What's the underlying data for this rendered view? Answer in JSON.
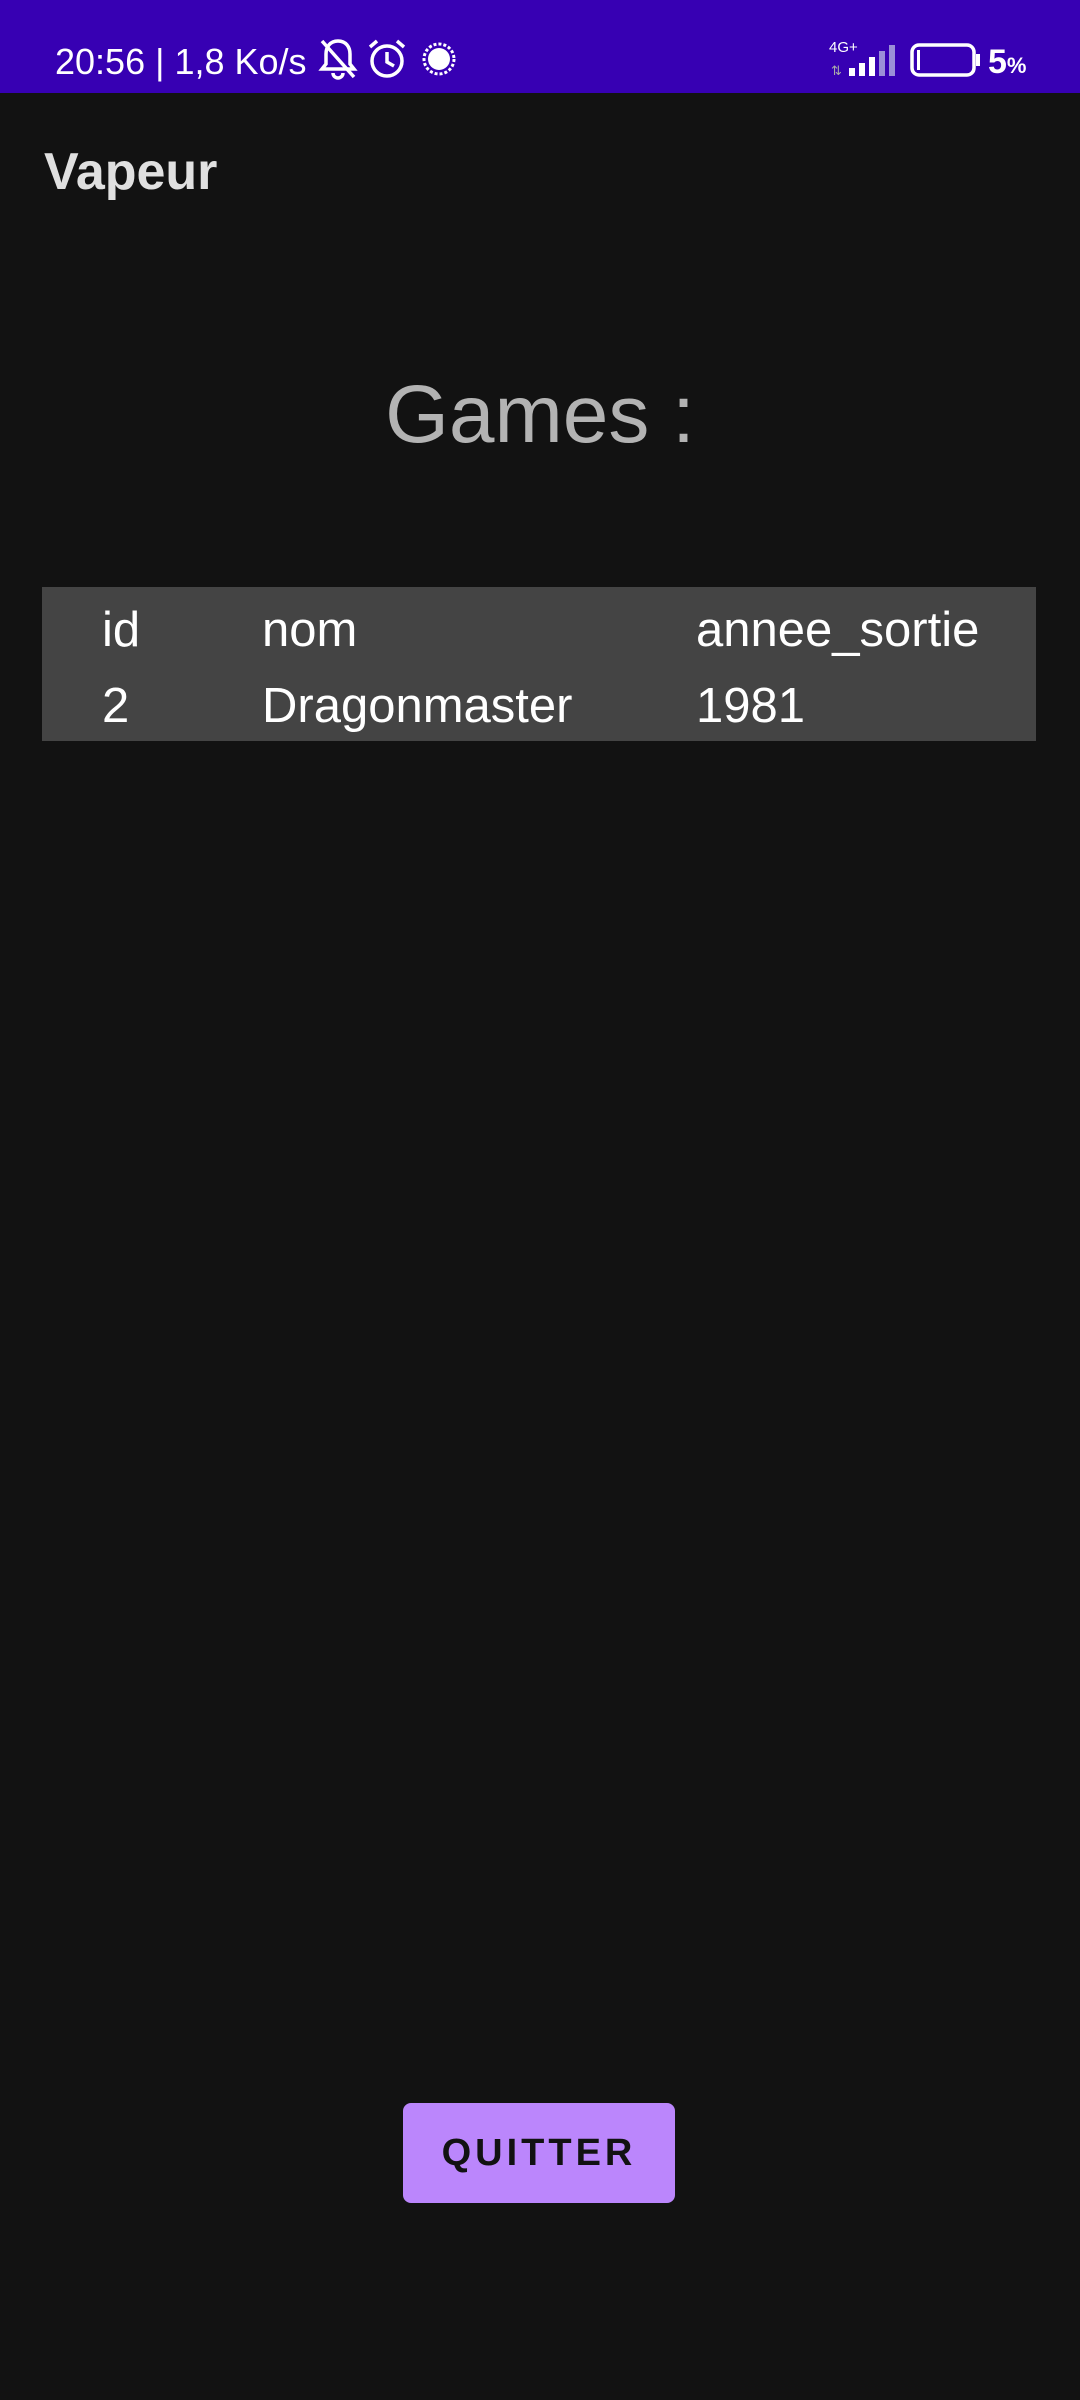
{
  "status_bar": {
    "time_speed": "20:56 | 1,8 Ko/s",
    "network": "4G+",
    "battery_pct": "5",
    "battery_pct_sign": "%",
    "icons": [
      "bell-off-icon",
      "alarm-icon",
      "notification-dot-icon",
      "signal-icon",
      "battery-icon"
    ],
    "color": "#3700b3"
  },
  "app_bar": {
    "title": "Vapeur"
  },
  "main": {
    "heading": "Games :",
    "table": {
      "headers": [
        "id",
        "nom",
        "annee_sortie"
      ],
      "rows": [
        [
          "2",
          "Dragonmaster",
          "1981"
        ]
      ]
    },
    "quit_label": "QUITTER",
    "accent": "#bb86fc"
  }
}
